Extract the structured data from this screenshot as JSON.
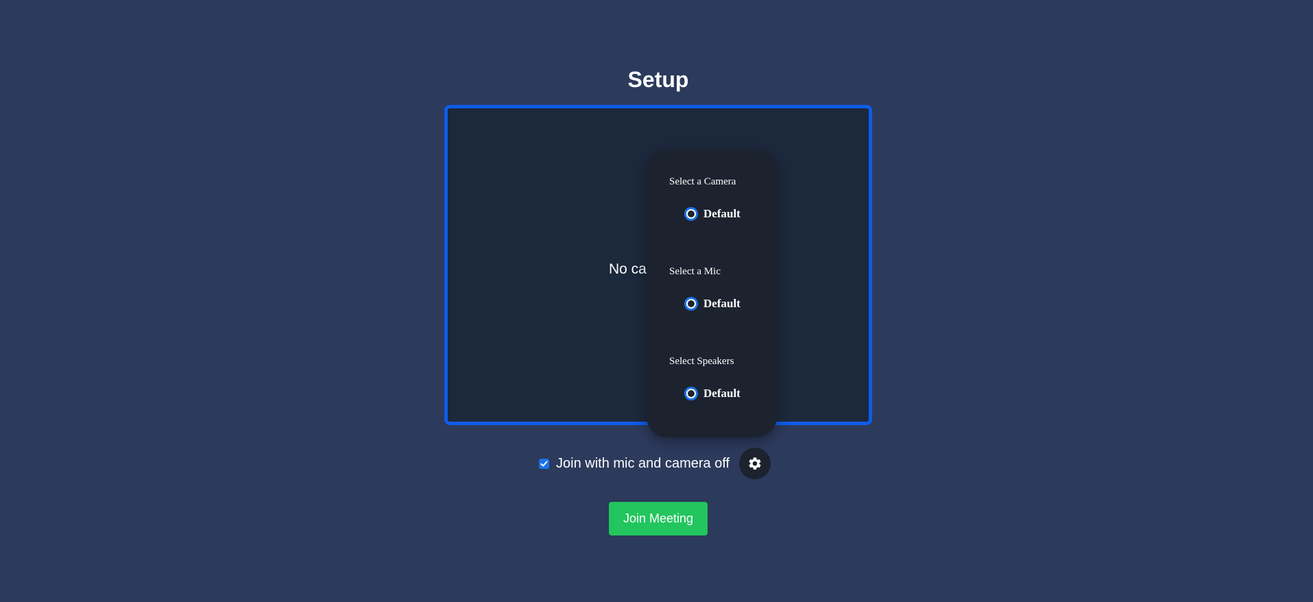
{
  "page": {
    "title": "Setup"
  },
  "preview": {
    "message": "No camera"
  },
  "device_menu": {
    "camera": {
      "heading": "Select a Camera",
      "option": "Default"
    },
    "mic": {
      "heading": "Select a Mic",
      "option": "Default"
    },
    "speakers": {
      "heading": "Select Speakers",
      "option": "Default"
    }
  },
  "controls": {
    "join_off_label": "Join with mic and camera off",
    "join_off_checked": true,
    "settings_icon": "gear-icon"
  },
  "join_button": {
    "label": "Join Meeting"
  },
  "colors": {
    "background": "#2c3a5c",
    "preview_border": "#0f5ce8",
    "preview_bg": "#1c283b",
    "menu_bg": "#1c232f",
    "accent": "#1a73e8",
    "join_button": "#22c55e"
  }
}
